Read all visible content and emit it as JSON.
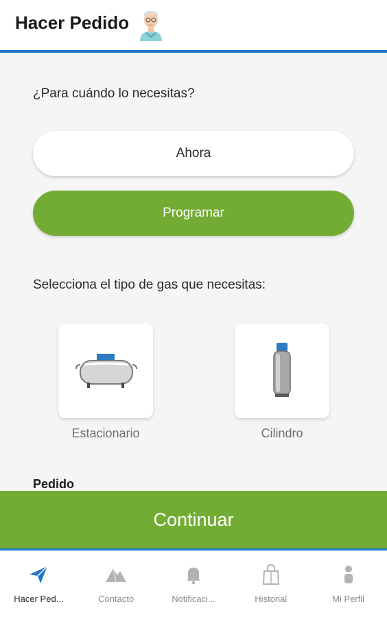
{
  "header": {
    "title": "Hacer Pedido",
    "avatar_icon": "user-avatar-icon",
    "accent_color": "#1f78c8"
  },
  "schedule": {
    "question": "¿Para cuándo lo necesitas?",
    "now_label": "Ahora",
    "schedule_label": "Programar"
  },
  "gas": {
    "question": "Selecciona el tipo de gas que necesitas:",
    "options": [
      {
        "label": "Estacionario",
        "icon": "stationary-tank-icon"
      },
      {
        "label": "Cilindro",
        "icon": "gas-cylinder-icon"
      }
    ]
  },
  "order": {
    "section_label": "Pedido"
  },
  "continue_label": "Continuar",
  "brand_color": "#72ac35",
  "nav": {
    "items": [
      {
        "label": "Hacer Ped...",
        "icon": "send-icon",
        "active": true
      },
      {
        "label": "Contacto",
        "icon": "mountain-icon",
        "active": false
      },
      {
        "label": "Notificaci...",
        "icon": "bell-icon",
        "active": false
      },
      {
        "label": "Historial",
        "icon": "shopping-bag-icon",
        "active": false
      },
      {
        "label": "Mi Perfil",
        "icon": "person-icon",
        "active": false
      }
    ]
  }
}
